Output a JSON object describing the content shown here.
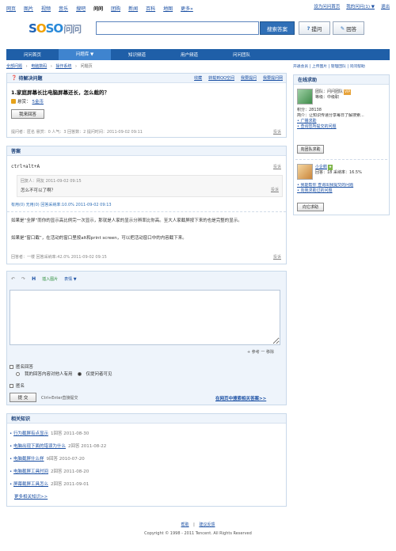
{
  "topnav": {
    "items": [
      "网页",
      "图片",
      "视频",
      "音乐",
      "搜吧",
      "问问",
      "团购",
      "新闻",
      "百科",
      "地图",
      "更多»"
    ],
    "current_index": 5,
    "right": [
      "设为问问首页",
      "我的问问(1) ▼",
      "退出"
    ]
  },
  "logo": {
    "s1": "S",
    "o": "O",
    "s2": "SO",
    "cn": "问问"
  },
  "search": {
    "value": "",
    "button": "搜索答案"
  },
  "ask_button": "提问",
  "answer_button": "回答",
  "mainnav": [
    "问问首页",
    "问题库 ▼",
    "知识频道",
    "用户频道",
    "问问团队"
  ],
  "mainnav_active_index": 1,
  "crumb": [
    "全部问题",
    "›",
    "电脑数码",
    "›",
    "操作系统",
    "›",
    "问题页"
  ],
  "rightlinks": "开通会员 | 上传图片 | 管理团队 | 问问帮助",
  "question": {
    "status": "待解决问题",
    "actions": [
      "收藏",
      "转载到QQ空间",
      "我要提问",
      "我要提问网"
    ],
    "title": "1.家庭屏幕长比电脑屏幕还长，怎么截的？",
    "reward_label": "悬赏：",
    "reward_link": "5金币",
    "answer_btn": "我来回答",
    "meta": "提问者：匿名  悬赏：0  人气：3  回答数：2  提问时间：2011-09-02 09:11",
    "report": "投诉"
  },
  "answers": {
    "header": "答案",
    "a1_text": "ctrl+alt+A",
    "a1_report": "投诉",
    "comment_user": "回复人：网友   2011-09-02 09:15",
    "comment_text": "怎么不可以了啊？",
    "comment_report": "投诉",
    "a1_meta": "有用(0)  无用(0)  回答采纳率:10.0%  2011-09-02 09:13",
    "a2_p1": "如果是“全屏”而你的显示高比例完一次显示，那就是人家的显示分辨率比你高。至大人家截屏按下来的也是完整的显示。",
    "a2_p2": "如果是“窗口截”，在活动的窗口里按alt和print screen，可以把活动窗口中的内容截下来。",
    "a2_meta": "回答者：一楼  回答采纳率:42.0%  2011-09-02 09:15",
    "a2_report": "投诉"
  },
  "editor": {
    "toolbar": [
      "↶",
      "↷",
      "H",
      "插入图片",
      "表情 ▼"
    ],
    "count_label": "+ 参考  一 移除",
    "anon_label": "匿名回答",
    "option1": "我的回答内容对他人有用",
    "option2": "仅提问者可见",
    "hide_label": "匿名",
    "submit": "提 交",
    "shortcut": "Ctrl+Enter直接提交",
    "more_link": "在网页中搜索相关答案>>"
  },
  "related": {
    "header": "相关知识",
    "items": [
      {
        "title": "行为截屏有点显示",
        "meta": "1回答  2011-08-30"
      },
      {
        "title": "电脑出现下面的错误为什么",
        "meta": "2回答  2011-08-22"
      },
      {
        "title": "电脑截屏什么样",
        "meta": "9回答  2010-07-20"
      },
      {
        "title": "电脑截屏工具时间",
        "meta": "2回答  2011-08-20"
      },
      {
        "title": "屏幕截屏工具怎么",
        "meta": "2回答  2011-09-01"
      }
    ],
    "more": "更多相关知识>>"
  },
  "sidebar": {
    "header": "在线求助",
    "u1_name": "团队：问问团队",
    "u1_level": "等级：中级职",
    "u1_score": "积分：28138",
    "u1_intro": "简介：让知识传递分享每日了解搜索...",
    "u1_links": [
      "广播求助",
      "查询您所提交的问题"
    ],
    "u1_btn": "向团队求助",
    "u2_name": "小企鹅",
    "u2_stat": "回答：18  采纳率：16.5%",
    "u2_links": [
      "我能帮你   查询出我提交的问题",
      "向我求助过的问题"
    ],
    "u2_btn": "向它求助"
  },
  "footer": {
    "links": [
      "帮助",
      "建议反馈"
    ],
    "copyright": "Copyright © 1998 - 2011 Tencent. All Rights Reserved"
  }
}
